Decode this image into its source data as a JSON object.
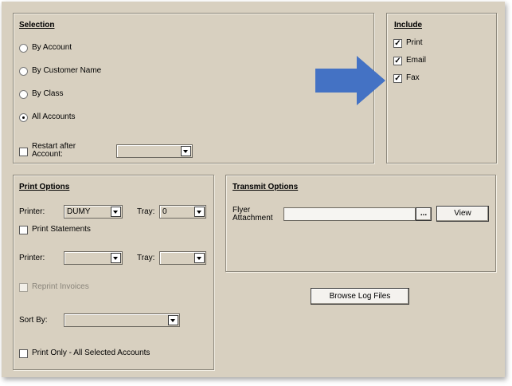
{
  "selection": {
    "title": "Selection",
    "options": [
      "By Account",
      "By Customer Name",
      "By Class",
      "All Accounts"
    ],
    "selected": "All Accounts",
    "restart_label": "Restart after Account:",
    "restart_line1": "Restart after",
    "restart_line2": "Account:",
    "restart_value": ""
  },
  "include": {
    "title": "Include",
    "print_label": "Print",
    "email_label": "Email",
    "fax_label": "Fax"
  },
  "print_options": {
    "title": "Print Options",
    "printer_label": "Printer:",
    "printer1_value": "DUMY",
    "tray_label": "Tray:",
    "tray1_value": "0",
    "print_statements_label": "Print Statements",
    "printer2_value": "",
    "tray2_value": "",
    "reprint_invoices_label": "Reprint Invoices",
    "sort_by_label": "Sort By:",
    "sort_by_value": "",
    "print_only_label": "Print Only - All Selected Accounts"
  },
  "transmit_options": {
    "title": "Transmit Options",
    "flyer_line1": "Flyer",
    "flyer_line2": "Attachment",
    "flyer_value": "",
    "browse_label": "...",
    "view_label": "View"
  },
  "browse_log_label": "Browse Log Files",
  "colors": {
    "panel_bg": "#d8d0c0",
    "arrow_fill": "#4472c4"
  }
}
